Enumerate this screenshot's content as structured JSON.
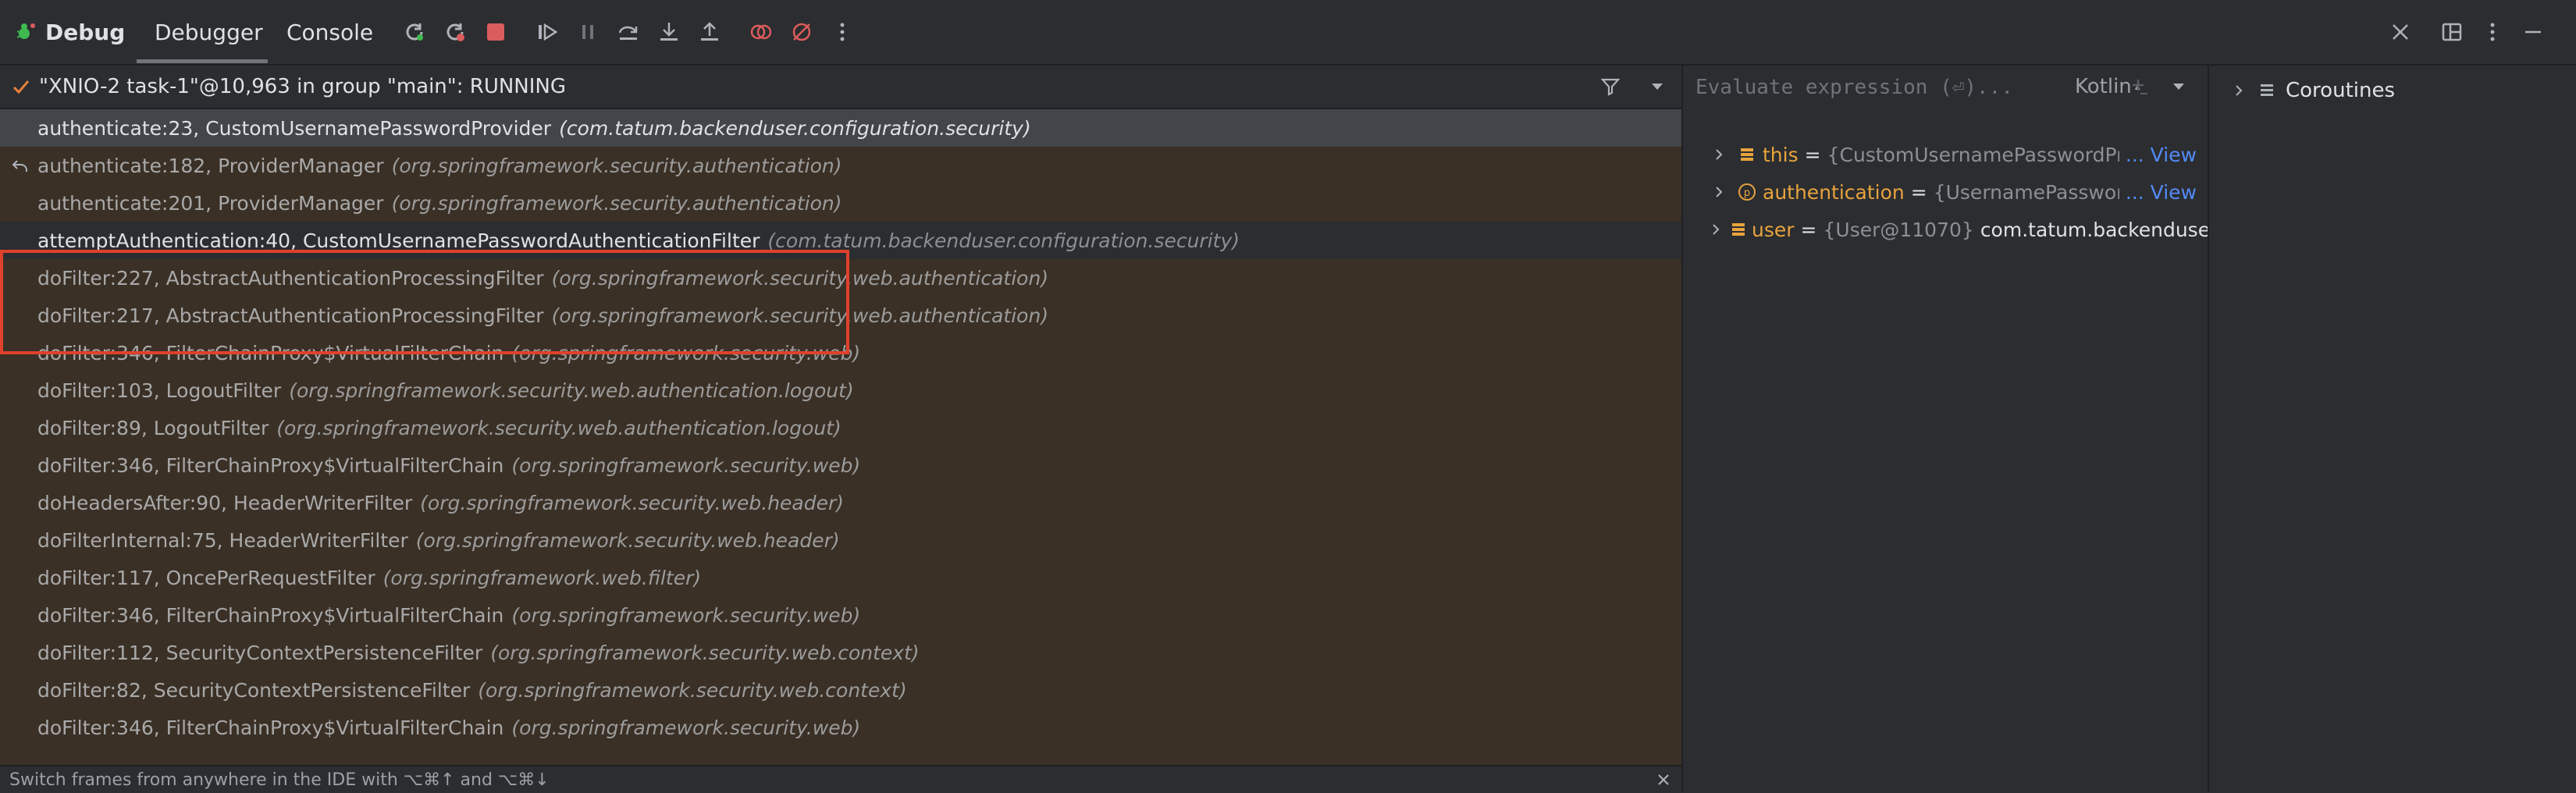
{
  "toolbar": {
    "title": "Debug",
    "tabs": [
      {
        "label": "Debugger",
        "active": true
      },
      {
        "label": "Console",
        "active": false
      }
    ],
    "icons": [
      "rerun-icon",
      "rerun-failed-icon",
      "stop-icon",
      "resume-icon",
      "pause-icon",
      "step-over-icon",
      "step-into-icon",
      "step-out-icon",
      "view-breakpoints-icon",
      "mute-breakpoints-icon",
      "more-icon",
      "close-icon",
      "layout-icon",
      "options-icon",
      "minimize-icon"
    ]
  },
  "thread": {
    "label": "\"XNIO-2 task-1\"@10,963 in group \"main\": RUNNING",
    "status_icon": "check-icon"
  },
  "frames": [
    {
      "name": "authenticate:23, CustomUsernamePasswordProvider",
      "pkg": "(com.tatum.backenduser.configuration.security)",
      "state": "selected"
    },
    {
      "name": "authenticate:182, ProviderManager",
      "pkg": "(org.springframework.security.authentication)",
      "state": "library",
      "drop_frame": true
    },
    {
      "name": "authenticate:201, ProviderManager",
      "pkg": "(org.springframework.security.authentication)",
      "state": "library"
    },
    {
      "name": "attemptAuthentication:40, CustomUsernamePasswordAuthenticationFilter",
      "pkg": "(com.tatum.backenduser.configuration.security)",
      "state": "neutral"
    },
    {
      "name": "doFilter:227, AbstractAuthenticationProcessingFilter",
      "pkg": "(org.springframework.security.web.authentication)",
      "state": "library"
    },
    {
      "name": "doFilter:217, AbstractAuthenticationProcessingFilter",
      "pkg": "(org.springframework.security.web.authentication)",
      "state": "library"
    },
    {
      "name": "doFilter:346, FilterChainProxy$VirtualFilterChain",
      "pkg": "(org.springframework.security.web)",
      "state": "library"
    },
    {
      "name": "doFilter:103, LogoutFilter",
      "pkg": "(org.springframework.security.web.authentication.logout)",
      "state": "library"
    },
    {
      "name": "doFilter:89, LogoutFilter",
      "pkg": "(org.springframework.security.web.authentication.logout)",
      "state": "library"
    },
    {
      "name": "doFilter:346, FilterChainProxy$VirtualFilterChain",
      "pkg": "(org.springframework.security.web)",
      "state": "library"
    },
    {
      "name": "doHeadersAfter:90, HeaderWriterFilter",
      "pkg": "(org.springframework.security.web.header)",
      "state": "library"
    },
    {
      "name": "doFilterInternal:75, HeaderWriterFilter",
      "pkg": "(org.springframework.security.web.header)",
      "state": "library"
    },
    {
      "name": "doFilter:117, OncePerRequestFilter",
      "pkg": "(org.springframework.web.filter)",
      "state": "library"
    },
    {
      "name": "doFilter:346, FilterChainProxy$VirtualFilterChain",
      "pkg": "(org.springframework.security.web)",
      "state": "library"
    },
    {
      "name": "doFilter:112, SecurityContextPersistenceFilter",
      "pkg": "(org.springframework.security.web.context)",
      "state": "library"
    },
    {
      "name": "doFilter:82, SecurityContextPersistenceFilter",
      "pkg": "(org.springframework.security.web.context)",
      "state": "library"
    },
    {
      "name": "doFilter:346, FilterChainProxy$VirtualFilterChain",
      "pkg": "(org.springframework.security.web)",
      "state": "library"
    }
  ],
  "status": {
    "hint": "Switch frames from anywhere in the IDE with ⌥⌘↑ and ⌥⌘↓"
  },
  "evaluate": {
    "placeholder": "Evaluate expression (⏎)...",
    "language": "Kotlin"
  },
  "variables": [
    {
      "name": "this",
      "eq": "=",
      "value": "{CustomUsernamePasswordPro",
      "extra": "",
      "link": "... View",
      "icon": "field-icon"
    },
    {
      "name": "authentication",
      "eq": "=",
      "value": "{UsernamePasswordA",
      "extra": "",
      "link": "... View",
      "icon": "parameter-icon"
    },
    {
      "name": "user",
      "eq": "=",
      "value": "{User@11070}",
      "extra": "com.tatum.backenduser.",
      "link": "",
      "icon": "field-icon"
    }
  ],
  "coroutines": {
    "label": "Coroutines"
  },
  "colors": {
    "accent_green": "#3fb950",
    "stop_red": "#db5c5c",
    "highlight_red": "#e0412c",
    "link_blue": "#548af7",
    "var_name": "#e8a33d",
    "library_bg": "#3a3026"
  }
}
